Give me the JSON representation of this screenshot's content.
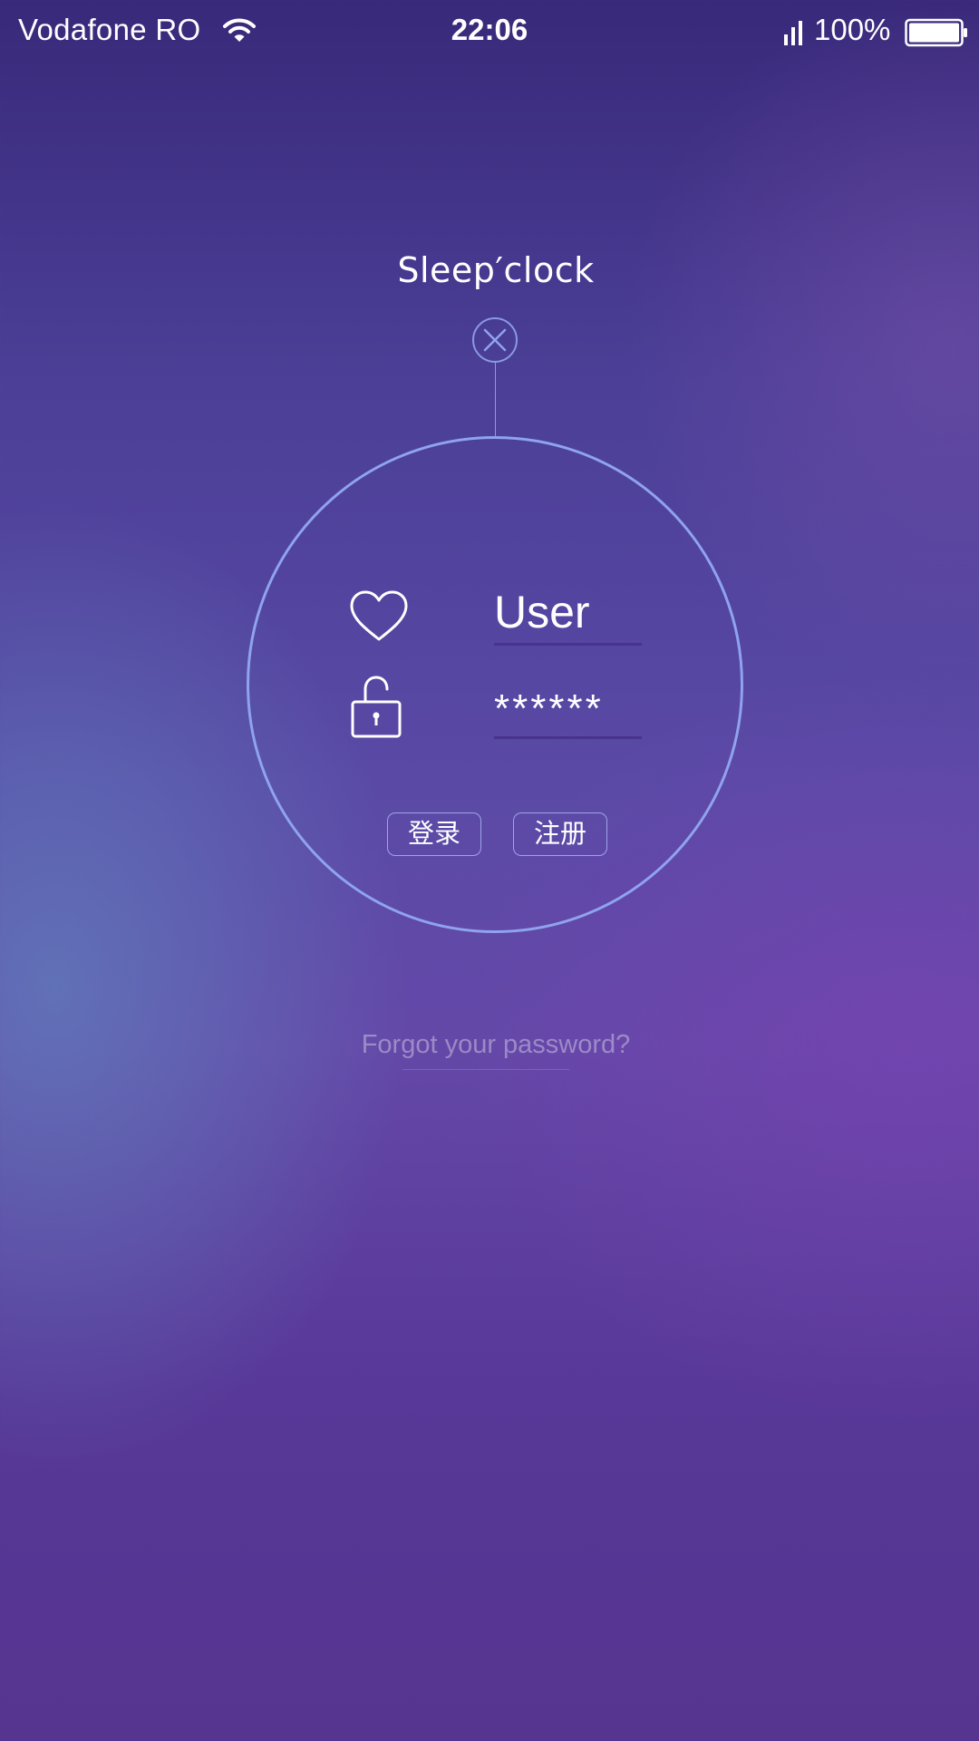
{
  "status_bar": {
    "carrier": "Vodafone RO",
    "time": "22:06",
    "battery": "100%",
    "icons": [
      "wifi-icon",
      "signal-icon",
      "battery-icon"
    ]
  },
  "app": {
    "title": "Sleep′clock",
    "close_icon": "close-icon"
  },
  "login_form": {
    "username_icon": "heart-icon",
    "password_icon": "unlock-icon",
    "username_value": "User",
    "password_value": "******",
    "login_button": "登录",
    "register_button": "注册"
  },
  "forgot_password": "Forgot your password?",
  "colors": {
    "accent_ring": "#8fa3ef",
    "underline": "#4a338e",
    "background_top": "#39297a",
    "background_bottom": "#55358f"
  }
}
